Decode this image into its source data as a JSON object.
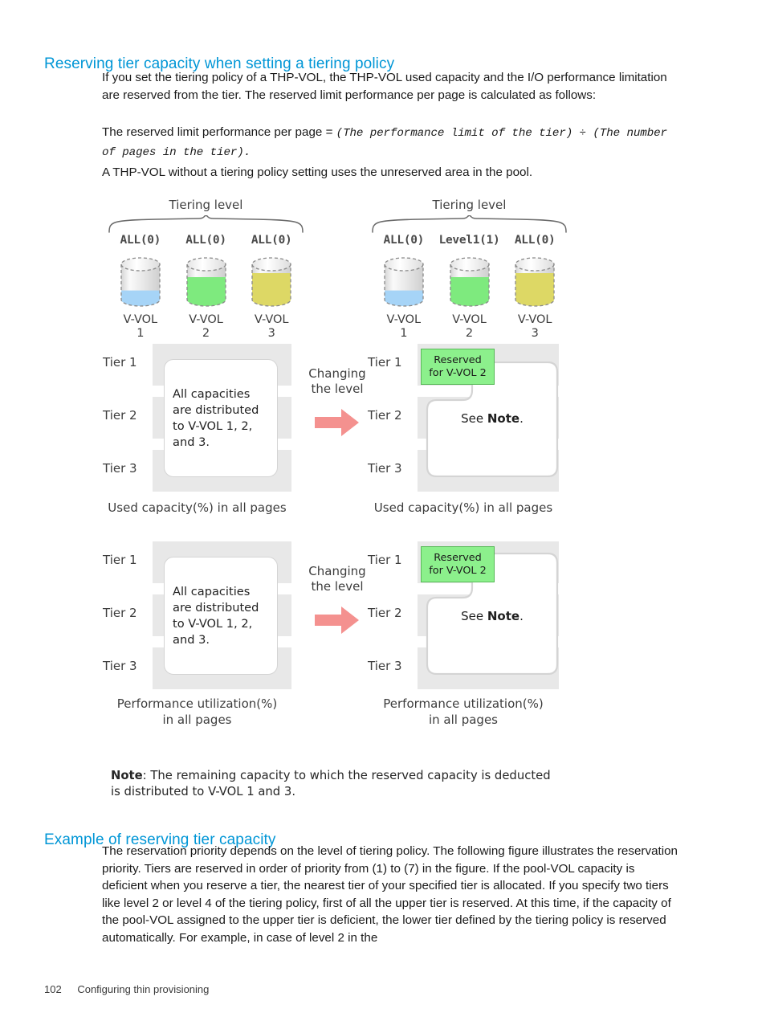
{
  "document": {
    "footer": {
      "page_number": "102",
      "section": "Configuring thin provisioning"
    }
  },
  "section1": {
    "heading": "Reserving tier capacity when setting a tiering policy",
    "paragraph1": "If you set the tiering policy of a THP-VOL, the THP-VOL used capacity and the I/O performance limitation are reserved from the tier. The reserved limit performance per page is calculated as follows:",
    "formula_prefix": "The reserved limit performance per page = ",
    "formula_mono": "(The performance limit of the tier) ÷ (The number of pages in the tier).",
    "paragraph2": "A THP-VOL without a tiering policy setting uses the unreserved area in the pool."
  },
  "figure": {
    "left_group": {
      "title": "Tiering level",
      "policies": [
        "ALL(0)",
        "ALL(0)",
        "ALL(0)"
      ],
      "volumes": [
        {
          "name": "V-VOL",
          "num": "1",
          "fill_color": "#a6d4f7",
          "fill_pct": 26
        },
        {
          "name": "V-VOL",
          "num": "2",
          "fill_color": "#7eea7e",
          "fill_pct": 62
        },
        {
          "name": "V-VOL",
          "num": "3",
          "fill_color": "#ddd865",
          "fill_pct": 72
        }
      ]
    },
    "right_group": {
      "title": "Tiering level",
      "policies": [
        "ALL(0)",
        "Level1(1)",
        "ALL(0)"
      ],
      "volumes": [
        {
          "name": "V-VOL",
          "num": "1",
          "fill_color": "#a6d4f7",
          "fill_pct": 26
        },
        {
          "name": "V-VOL",
          "num": "2",
          "fill_color": "#7eea7e",
          "fill_pct": 62
        },
        {
          "name": "V-VOL",
          "num": "3",
          "fill_color": "#ddd865",
          "fill_pct": 72
        }
      ]
    },
    "tier_labels": [
      "Tier 1",
      "Tier 2",
      "Tier 3"
    ],
    "change_label_line1": "Changing",
    "change_label_line2": "the level",
    "before_overlay_text": "All capacities are distributed to V-VOL 1, 2, and 3.",
    "after_overlay_prefix": "See ",
    "after_overlay_bold": "Note",
    "after_overlay_suffix": ".",
    "reserved_line1": "Reserved",
    "reserved_line2": "for V-VOL 2",
    "caption_used_left": "Used capacity(%) in all pages",
    "caption_used_right": "Used capacity(%) in all pages",
    "caption_perf_left_line1": "Performance utilization(%)",
    "caption_perf_left_line2": "in all pages",
    "caption_perf_right_line1": "Performance utilization(%)",
    "caption_perf_right_line2": "in all pages",
    "note_bold": "Note",
    "note_text": ": The remaining capacity to which the reserved capacity is deducted is distributed to V-VOL 1 and 3.",
    "colors": {
      "tier_bar": "#e8e8e8",
      "arrow": "#f4918f",
      "reserved_fill": "#8cf08c",
      "reserved_border": "#57b957",
      "heading_blue": "#0096d6"
    }
  },
  "section2": {
    "heading": "Example of reserving tier capacity",
    "paragraph": "The reservation priority depends on the level of tiering policy. The following figure illustrates the reservation priority. Tiers are reserved in order of priority from (1) to (7) in the figure. If the pool-VOL capacity is deficient when you reserve a tier, the nearest tier of your specified tier is allocated. If you specify two tiers like level 2 or level 4 of the tiering policy, first of all the upper tier is reserved. At this time, if the capacity of the pool-VOL assigned to the upper tier is deficient, the lower tier defined by the tiering policy is reserved automatically. For example, in case of level 2 in the"
  }
}
